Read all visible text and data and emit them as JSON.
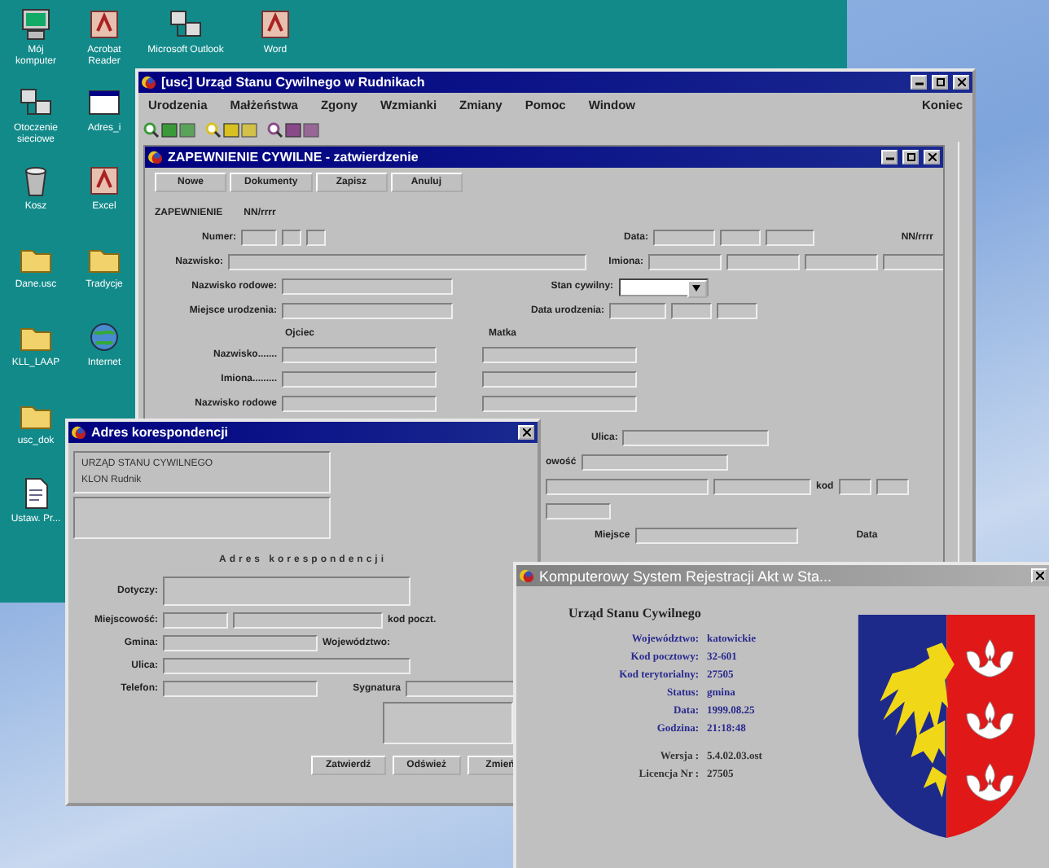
{
  "desktop": {
    "icon_columns": [
      [
        {
          "label": "Mój komputer",
          "kind": "computer"
        },
        {
          "label": "Otoczenie sieciowe",
          "kind": "network"
        },
        {
          "label": "Kosz",
          "kind": "bin"
        },
        {
          "label": "Dane.usc",
          "kind": "folder"
        },
        {
          "label": "KLL_LAAP",
          "kind": "folder"
        },
        {
          "label": "usc_dok",
          "kind": "folder"
        },
        {
          "label": "Ustaw. Pr...",
          "kind": "document"
        }
      ],
      [
        {
          "label": "Acrobat Reader",
          "kind": "app"
        },
        {
          "label": "Adres_i",
          "kind": "window"
        },
        {
          "label": "Excel",
          "kind": "app"
        },
        {
          "label": "Tradycje",
          "kind": "folder"
        },
        {
          "label": "Internet",
          "kind": "globe"
        }
      ],
      [
        {
          "label": "Microsoft Outlook",
          "kind": "network"
        }
      ],
      [
        {
          "label": "Word",
          "kind": "app"
        }
      ]
    ]
  },
  "main_window": {
    "title": "[usc] Urząd Stanu Cywilnego w Rudnikach",
    "menu": [
      "Urodzenia",
      "Małżeństwa",
      "Zgony",
      "Wzmianki",
      "Zmiany",
      "Pomoc",
      "Window",
      "Koniec"
    ],
    "toolbar_groups": [
      {
        "color": "#3a9a3a"
      },
      {
        "color": "#d8c020"
      },
      {
        "color": "#8a4a8a"
      }
    ],
    "inner_window": {
      "title": "ZAPEWNIENIE CYWILNE - zatwierdzenie",
      "buttons": [
        "Nowe",
        "Dokumenty",
        "Zapisz",
        "Anuluj"
      ],
      "form": {
        "record_label": "ZAPEWNIENIE",
        "record_format": "NN/rrrr",
        "number_label": "Numer:",
        "date_label": "Data:",
        "date_format": "NN/rrrr",
        "surname_label": "Nazwisko:",
        "names_label": "Imiona:",
        "maiden_label": "Nazwisko rodowe:",
        "civil_status_label": "Stan cywilny:",
        "birthplace_label": "Miejsce urodzenia:",
        "birthdate_label": "Data urodzenia:",
        "father_heading": "Ojciec",
        "mother_heading": "Matka",
        "parent_rows": [
          "Nazwisko.......",
          "Imiona.........",
          "Nazwisko rodowe"
        ],
        "street_label": "Ulica:",
        "town_label": "owość",
        "postcode_label": "kod",
        "place_label": "Miejsce",
        "date2_label": "Data"
      }
    }
  },
  "address_dialog": {
    "title": "Adres korespondencji",
    "sender_lines": [
      "URZĄD STANU CYWILNEGO",
      "KLON Rudnik"
    ],
    "heading": "Adres korespondencji",
    "concerns_label": "Dotyczy:",
    "town_label": "Miejscowość:",
    "postcode_label": "kod poczt.",
    "commune_label": "Gmina:",
    "province_label": "Województwo:",
    "street_label": "Ulica:",
    "phone_label": "Telefon:",
    "signature_label": "Sygnatura",
    "buttons": [
      "Zatwierdź",
      "Odśwież",
      "Zmień"
    ]
  },
  "about_window": {
    "title": "Komputerowy System Rejestracji Akt w Sta...",
    "office": "Urząd Stanu Cywilnego",
    "rows": [
      {
        "label": "Województwo:",
        "value": "katowickie"
      },
      {
        "label": "Kod pocztowy:",
        "value": "32-601"
      },
      {
        "label": "Kod terytorialny:",
        "value": "27505"
      },
      {
        "label": "Status:",
        "value": "gmina"
      },
      {
        "label": "Data:",
        "value": "1999.08.25"
      },
      {
        "label": "Godzina:",
        "value": "21:18:48"
      }
    ],
    "version_rows": [
      {
        "label": "Wersja :",
        "value": "5.4.02.03.ost"
      },
      {
        "label": "Licencja Nr :",
        "value": "27505"
      }
    ]
  }
}
